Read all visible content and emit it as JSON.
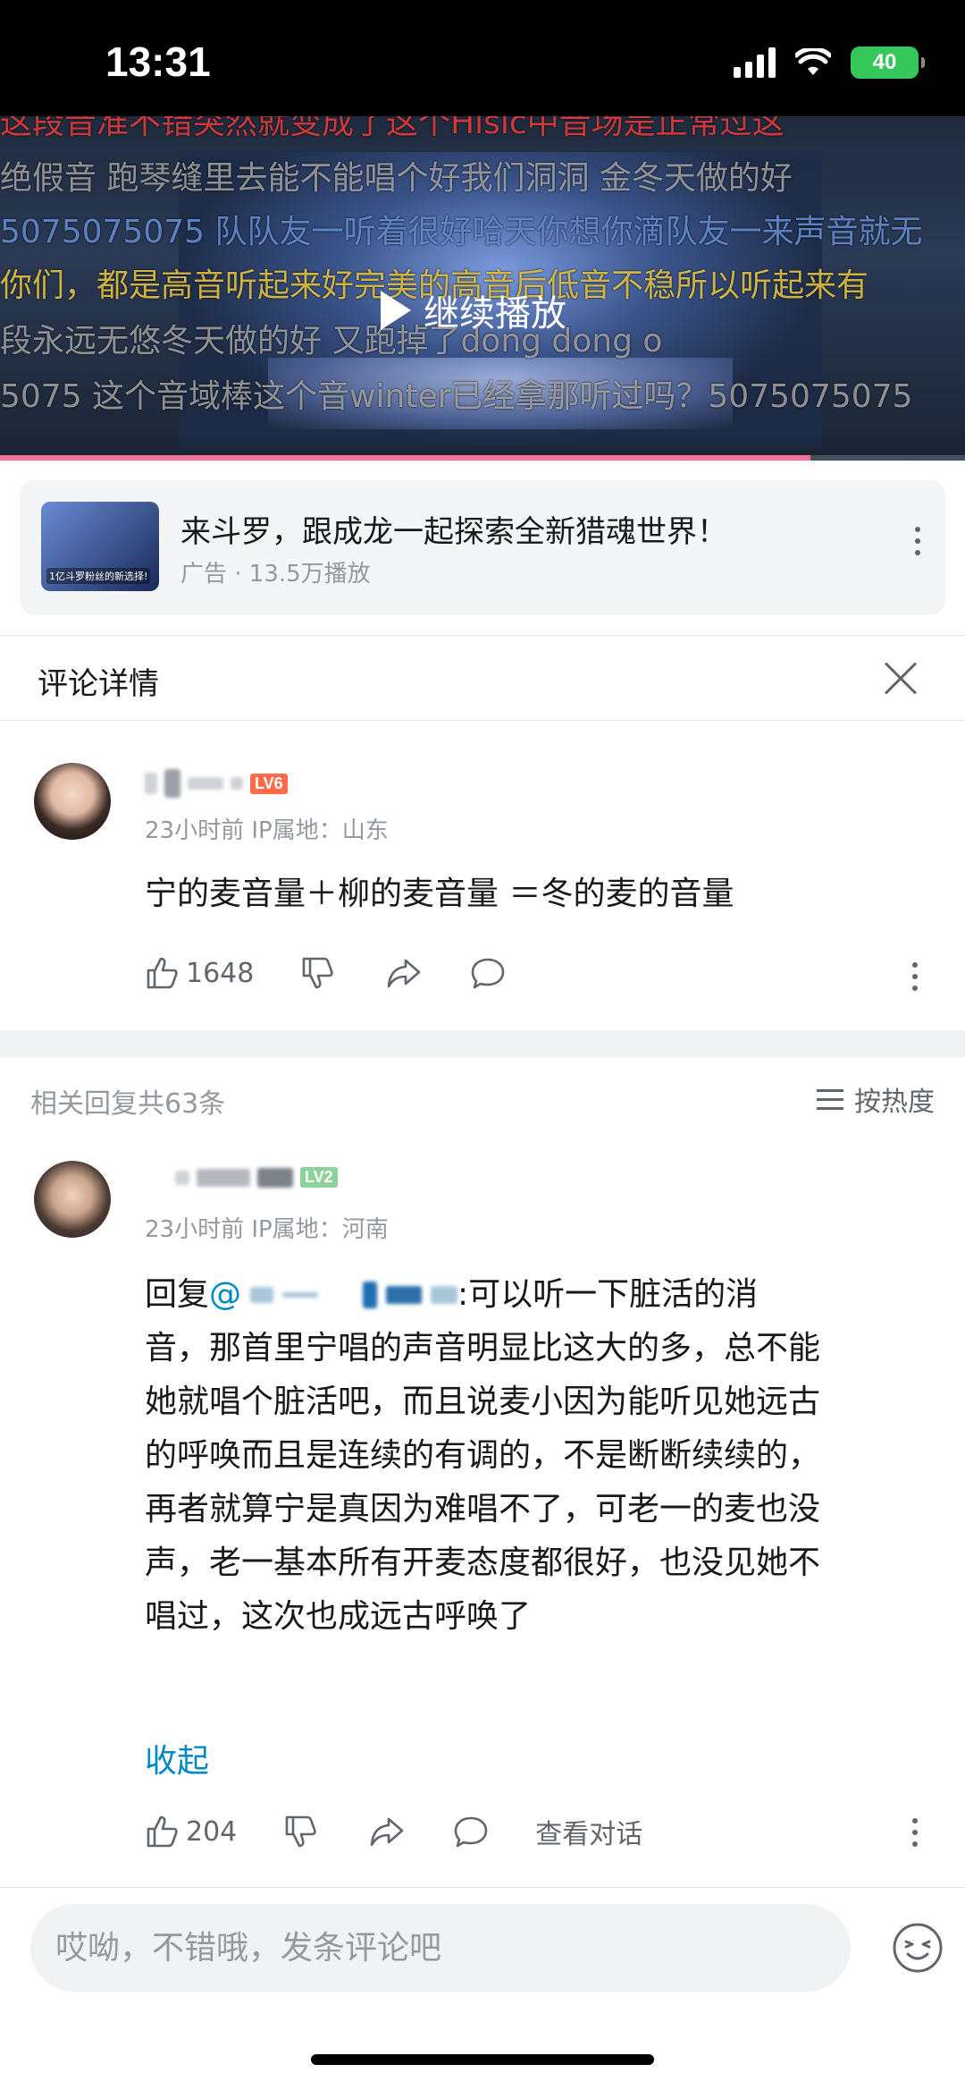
{
  "status_bar": {
    "time": "13:31",
    "battery": "40"
  },
  "video": {
    "play_label": "继续播放",
    "progress": 0.84,
    "danmaku": [
      {
        "text": "这段音准不错突然就变成了这个Hisic中音场是正常过这",
        "cls": "dm-red"
      },
      {
        "text": "绝假音 跑琴缝里去能不能唱个好我们洞洞  金冬天做的好",
        "cls": ""
      },
      {
        "text": "5075075075 队队友一听着很好哈天你想你滴队友一来声音就无",
        "cls": "dm-blue"
      },
      {
        "text": "你们，都是高音听起来好完美的高音后低音不稳所以听起来有",
        "cls": "dm-yellow"
      },
      {
        "text": "段永远无悠冬天做的好     又跑掉了dong dong o",
        "cls": ""
      },
      {
        "text": "5075 这个音域棒这个音winter已经拿那听过吗？5075075075",
        "cls": ""
      }
    ]
  },
  "ad": {
    "title": "来斗罗，跟成龙一起探索全新猎魂世界！",
    "subtitle": "广告 · 13.5万播放",
    "thumb_text": "1亿斗罗粉丝的新选择!"
  },
  "detail": {
    "title": "评论详情"
  },
  "main_comment": {
    "level": "LV6",
    "meta": "23小时前  IP属地：山东",
    "text": "宁的麦音量＋柳的麦音量 ＝冬的麦的音量",
    "likes": "1648"
  },
  "replies": {
    "count_label": "相关回复共63条",
    "sort_label": "按热度"
  },
  "reply": {
    "level": "LV2",
    "meta": "23小时前  IP属地：河南",
    "reply_prefix": "回复 ",
    "mention": "@",
    "lines": [
      ":可以听一下脏活的消",
      "音，那首里宁唱的声音明显比这大的多，总不能",
      "她就唱个脏活吧，而且说麦小因为能听见她远古",
      "的呼唤而且是连续的有调的，不是断断续续的，",
      "再者就算宁是真因为难唱不了，可老一的麦也没",
      "声，老一基本所有开麦态度都很好，也没见她不",
      "唱过，这次也成远古呼唤了"
    ],
    "collapse_label": "收起",
    "likes": "204",
    "view_thread_label": "查看对话"
  },
  "input": {
    "placeholder": "哎呦，不错哦，发条评论吧"
  },
  "colors": {
    "accent": "#fb7299",
    "link": "#008ac5",
    "lv6": "#ff6a49",
    "lv2": "#8bd29b"
  }
}
